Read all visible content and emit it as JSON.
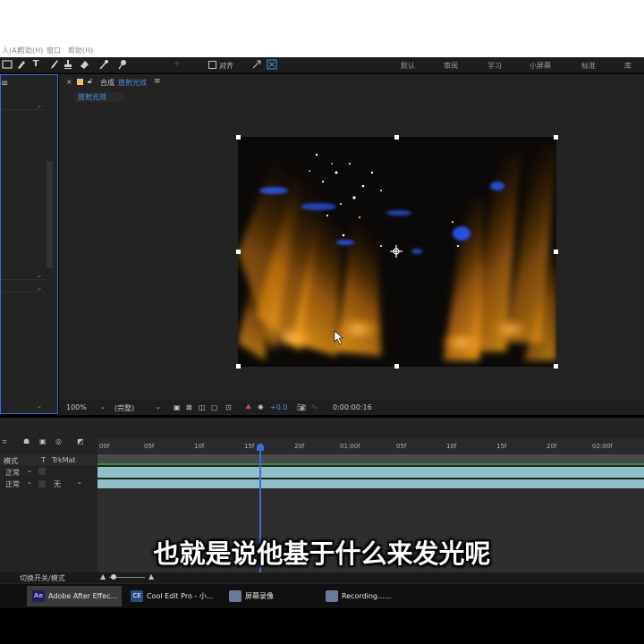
{
  "menu": {
    "items": [
      "人(A)",
      "帮助(H)",
      "窗口",
      "帮助(H)"
    ]
  },
  "toolbar": {
    "align_label": "对齐",
    "workspaces": [
      "默认",
      "审阅",
      "学习",
      "小屏幕",
      "标准",
      "库"
    ]
  },
  "comp": {
    "tab_label": "合成",
    "comp_name": "放射光效",
    "sub_tab": "放射光效",
    "zoom": "100%",
    "resolution": "(完整)",
    "exposure": "+0.0",
    "timecode": "0:00:00:16"
  },
  "timeline": {
    "col_mode": "模式",
    "col_t": "T",
    "col_trkmat": "TrkMat",
    "layers": [
      {
        "mode": "正常",
        "trkmat": ""
      },
      {
        "mode": "正常",
        "trkmat": "无"
      }
    ],
    "ticks": [
      "00f",
      "05f",
      "10f",
      "15f",
      "20f",
      "01:00f",
      "05f",
      "10f",
      "15f",
      "20f",
      "02:00f"
    ],
    "toggle_label": "切换开关/模式"
  },
  "caption": "也就是说他基于什么来发光呢",
  "taskbar": {
    "tasks": [
      {
        "label": "Adobe After Effec...",
        "icon": "Ae",
        "color": "#1f1f5a"
      },
      {
        "label": "Cool Edit Pro - 小...",
        "icon": "CE",
        "color": "#2a4a8a"
      },
      {
        "label": "屏幕录像",
        "icon": "",
        "color": "#6a7a9a"
      },
      {
        "label": "Recording......",
        "icon": "",
        "color": "#6a7a9a"
      }
    ]
  },
  "colors": {
    "accent": "#3d6bd8",
    "glow": "#f4a20c",
    "track": "#8fc0c8"
  }
}
